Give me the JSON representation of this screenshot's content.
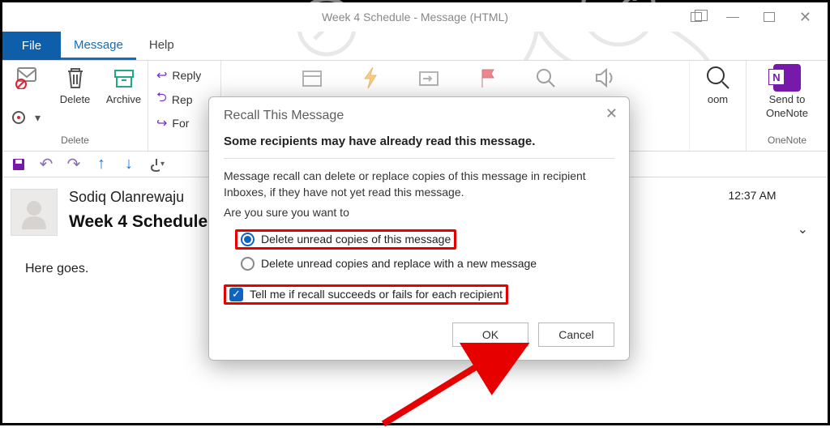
{
  "titlebar": {
    "title": "Week 4 Schedule  -  Message (HTML)"
  },
  "tabs": {
    "file": "File",
    "message": "Message",
    "help": "Help"
  },
  "ribbon": {
    "delete_group": {
      "label": "Delete",
      "delete_btn": "Delete",
      "archive_btn": "Archive"
    },
    "respond": {
      "reply": "Reply",
      "replyPrefix": "Rep",
      "forward": "For"
    },
    "zoom_label": "oom",
    "onenote": {
      "line1": "Send to",
      "line2": "OneNote",
      "group": "OneNote"
    }
  },
  "message": {
    "sender": "Sodiq Olanrewaju",
    "subject": "Week 4 Schedule",
    "time": "12:37 AM",
    "body": "Here goes."
  },
  "dialog": {
    "title": "Recall This Message",
    "bold": "Some recipients may have already read this message.",
    "explain": "Message recall can delete or replace copies of this message in recipient Inboxes, if they have not yet read this message.",
    "prompt": "Are you sure you want to",
    "opt1": "Delete unread copies of this message",
    "opt2": "Delete unread copies and replace with a new message",
    "check": "Tell me if recall succeeds or fails for each recipient",
    "ok": "OK",
    "cancel": "Cancel"
  }
}
